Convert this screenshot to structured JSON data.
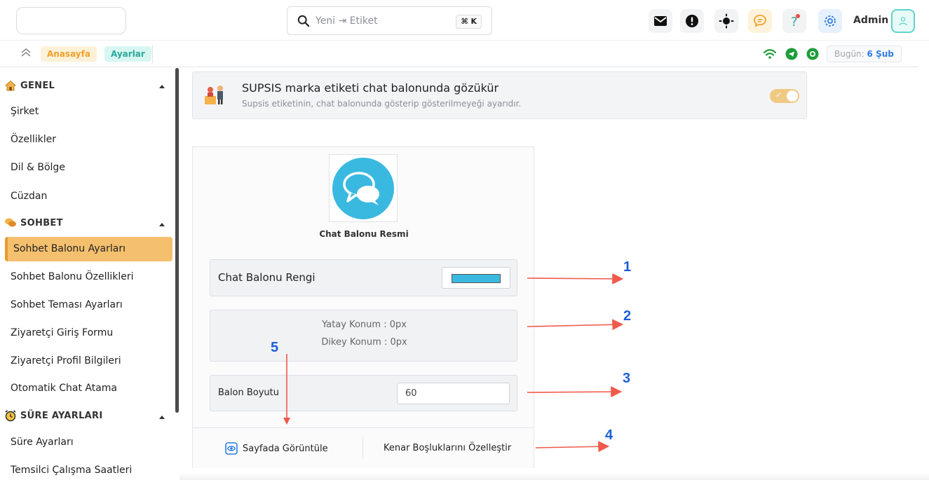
{
  "header": {
    "search_placeholder": "Yeni ⇥ Etiket",
    "search_shortcut": "⌘ K",
    "icons": [
      "mail-icon",
      "alert-icon",
      "theme-icon",
      "chat-icon",
      "help-icon",
      "settings-icon"
    ],
    "admin_name": "Admin"
  },
  "subbar": {
    "breadcrumb": [
      "Anasayfa",
      "Ayarlar"
    ],
    "today_label": "Bugün:",
    "today_value": "6 Şub",
    "status_icons": [
      "wifi-icon",
      "telegram-icon",
      "whatsapp-icon"
    ]
  },
  "sidebar": {
    "sections": [
      {
        "title": "GENEL",
        "items": [
          "Şirket",
          "Özellikler",
          "Dil & Bölge",
          "Cüzdan"
        ]
      },
      {
        "title": "SOHBET",
        "items": [
          "Sohbet Balonu Ayarları",
          "Sohbet Balonu Özellikleri",
          "Sohbet Teması Ayarları",
          "Ziyaretçi Giriş Formu",
          "Ziyaretçi Profil Bilgileri",
          "Otomatik Chat Atama"
        ]
      },
      {
        "title": "SÜRE AYARLARI",
        "items": [
          "Süre Ayarları",
          "Temsilci Çalışma Saatleri"
        ]
      }
    ],
    "active_item": "Sohbet Balonu Ayarları"
  },
  "branding": {
    "title": "SUPSIS marka etiketi chat balonunda gözükür",
    "subtitle": "Supsis etiketinin, chat balonunda gösterip gösterilmeyeği ayarıdır.",
    "enabled": true
  },
  "bubble_panel": {
    "image_label": "Chat Balonu Resmi",
    "color_label": "Chat Balonu Rengi",
    "color_value": "#3ab9e0",
    "horizontal_position": "Yatay Konum : 0px",
    "vertical_position": "Dikey Konum : 0px",
    "size_label": "Balon Boyutu",
    "size_value": "60",
    "preview_button": "Sayfada Görüntüle",
    "margins_button": "Kenar Boşluklarını Özelleştir"
  },
  "annotations": [
    "1",
    "2",
    "3",
    "4",
    "5"
  ],
  "colors": {
    "accent_orange": "#f5c06e",
    "bubble_blue": "#3ab9e0",
    "annotation_blue": "#1c5fd6",
    "arrow_red": "#ef5a4c"
  }
}
